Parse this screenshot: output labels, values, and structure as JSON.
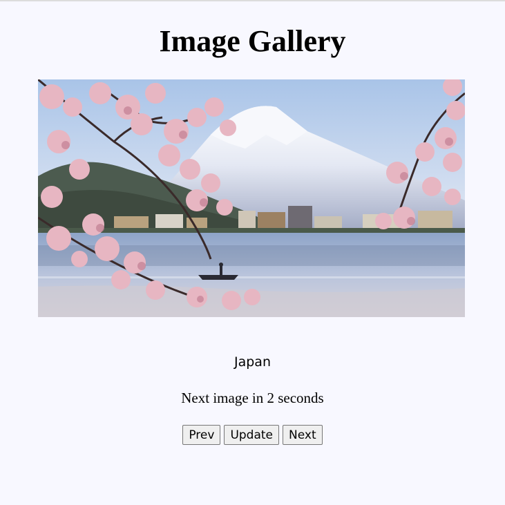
{
  "gallery": {
    "title": "Image Gallery",
    "caption": "Japan",
    "countdown": "Next image in 2 seconds",
    "image_subject": "mount-fuji-cherry-blossom-lake-photo"
  },
  "controls": {
    "prev_label": "Prev",
    "update_label": "Update",
    "next_label": "Next"
  },
  "colors": {
    "page_background": "#f8f8ff",
    "button_background": "#efefef",
    "button_border": "#767676"
  }
}
